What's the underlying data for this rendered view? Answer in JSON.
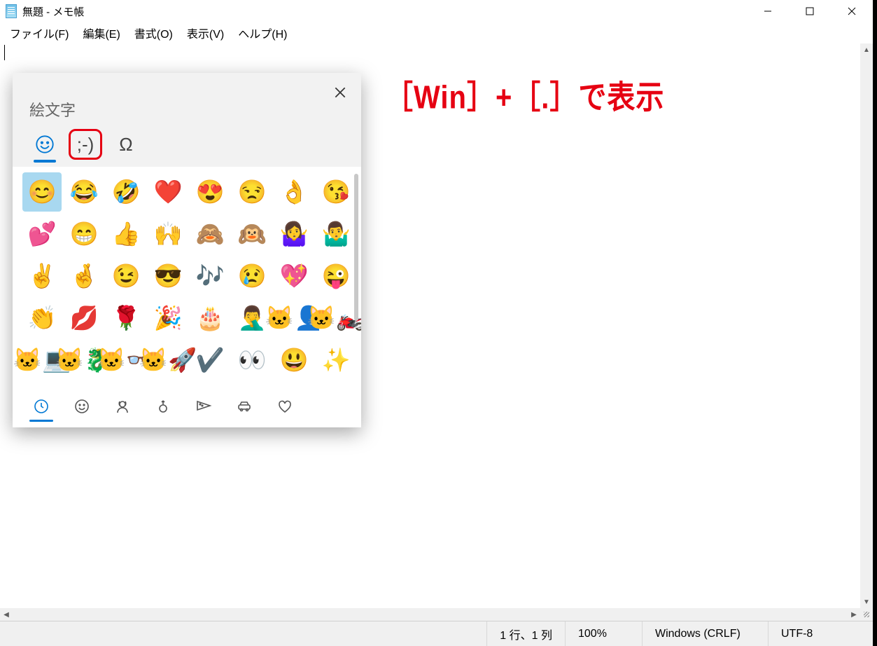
{
  "window": {
    "title": "無題 - メモ帳"
  },
  "menu": {
    "file": "ファイル(F)",
    "edit": "編集(E)",
    "format": "書式(O)",
    "view": "表示(V)",
    "help": "ヘルプ(H)"
  },
  "annotation": "［Win］+［.］で表示",
  "emoji_panel": {
    "title": "絵文字",
    "tabs": {
      "emoji": "☺",
      "kaomoji": ";-)",
      "symbols": "Ω"
    },
    "grid": [
      [
        "😊",
        "😂",
        "🤣",
        "❤️",
        "😍",
        "😒",
        "👌",
        "😘"
      ],
      [
        "💕",
        "😁",
        "👍",
        "🙌",
        "🙈",
        "🙉",
        "🤷‍♀️",
        "🤷‍♂️"
      ],
      [
        "✌️",
        "🤞",
        "😉",
        "😎",
        "🎶",
        "😢",
        "💖",
        "😜"
      ],
      [
        "👏",
        "💋",
        "🌹",
        "🎉",
        "🎂",
        "🤦‍♂️",
        "🐱‍👤",
        "🐱‍🏍"
      ],
      [
        "🐱‍💻",
        "🐱‍🐉",
        "🐱‍👓",
        "🐱‍🚀",
        "✔️",
        "👀",
        "😃",
        "✨"
      ]
    ],
    "selected_index": 0,
    "categories": [
      "🕒",
      "☺",
      "👧",
      "🎈",
      "🍕",
      "🚗",
      "♡"
    ]
  },
  "status": {
    "position": "1 行、1 列",
    "zoom": "100%",
    "line_ending": "Windows (CRLF)",
    "encoding": "UTF-8"
  }
}
